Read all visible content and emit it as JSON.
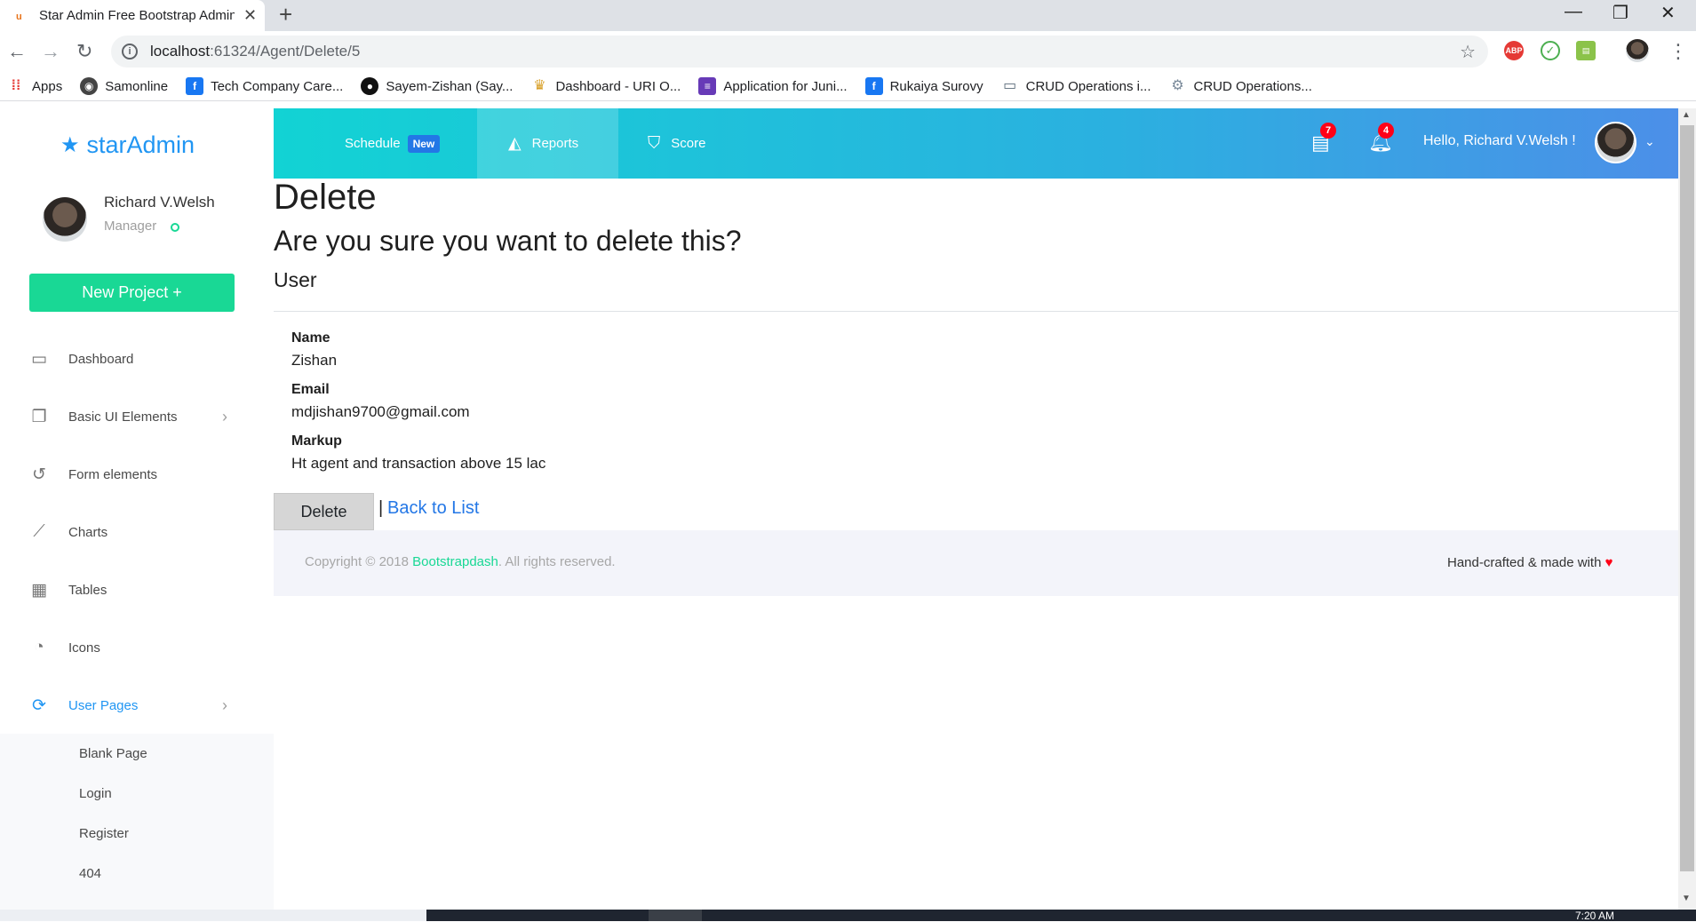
{
  "browser": {
    "tab_title": "Star Admin Free Bootstrap Admin",
    "tab_close": "✕",
    "new_tab": "+",
    "url_host": "localhost",
    "url_path": ":61324/Agent/Delete/5",
    "bookmarks": [
      {
        "label": "Apps",
        "icon": "apps-grid-icon",
        "color": "#4285f4"
      },
      {
        "label": "Samonline",
        "icon": "globe-icon",
        "color": "#444444"
      },
      {
        "label": "Tech Company Care...",
        "icon": "facebook-icon",
        "color": "#1877f2"
      },
      {
        "label": "Sayem-Zishan (Say...",
        "icon": "github-icon",
        "color": "#111111"
      },
      {
        "label": "Dashboard - URI O...",
        "icon": "trophy-icon",
        "color": "#d8a028"
      },
      {
        "label": "Application for Juni...",
        "icon": "form-icon",
        "color": "#673ab7"
      },
      {
        "label": "Rukaiya Surovy",
        "icon": "facebook-icon",
        "color": "#1877f2"
      },
      {
        "label": "CRUD Operations i...",
        "icon": "monitor-icon",
        "color": "#5a6b7a"
      },
      {
        "label": "CRUD Operations...",
        "icon": "settings-icon",
        "color": "#7a8a9a"
      }
    ]
  },
  "sidebar": {
    "brand_star": "★",
    "brand_prefix": "star",
    "brand_suffix": "Admin",
    "user_name": "Richard V.Welsh",
    "user_role": "Manager",
    "new_project": "New Project",
    "new_project_icon": "+",
    "items": [
      {
        "label": "Dashboard",
        "icon": "monitor-icon",
        "glyph": "▭",
        "has_chevron": false,
        "active": false
      },
      {
        "label": "Basic UI Elements",
        "icon": "copy-icon",
        "glyph": "❐",
        "has_chevron": true,
        "active": false
      },
      {
        "label": "Form elements",
        "icon": "history-icon",
        "glyph": "↺",
        "has_chevron": false,
        "active": false
      },
      {
        "label": "Charts",
        "icon": "chart-line-icon",
        "glyph": "⟋",
        "has_chevron": false,
        "active": false
      },
      {
        "label": "Tables",
        "icon": "table-icon",
        "glyph": "▦",
        "has_chevron": false,
        "active": false
      },
      {
        "label": "Icons",
        "icon": "palette-icon",
        "glyph": "◔",
        "has_chevron": false,
        "active": false
      },
      {
        "label": "User Pages",
        "icon": "restart-icon",
        "glyph": "⟳",
        "has_chevron": true,
        "active": true
      }
    ],
    "sub_items": [
      "Blank Page",
      "Login",
      "Register",
      "404"
    ],
    "chevron": "›"
  },
  "topbar": {
    "schedule": "Schedule",
    "schedule_badge": "New",
    "reports": "Reports",
    "score": "Score",
    "messages_count": "7",
    "notifications_count": "4",
    "greeting": "Hello, Richard V.Welsh !",
    "dropdown": "⌄"
  },
  "content": {
    "title": "Delete",
    "question": "Are you sure you want to delete this?",
    "entity": "User",
    "fields": [
      {
        "label": "Name",
        "value": "Zishan"
      },
      {
        "label": "Email",
        "value": "mdjishan9700@gmail.com"
      },
      {
        "label": "Markup",
        "value": "Ht agent and transaction above 15 lac"
      }
    ],
    "delete_button": "Delete",
    "separator": "|",
    "back_link": "Back to List"
  },
  "footer": {
    "copyright_prefix": "Copyright © 2018 ",
    "copyright_link": "Bootstrapdash",
    "copyright_suffix": ". All rights reserved.",
    "handcrafted": "Hand-crafted & made with ",
    "heart": "♥"
  },
  "taskbar": {
    "clock": "7:20 AM"
  }
}
